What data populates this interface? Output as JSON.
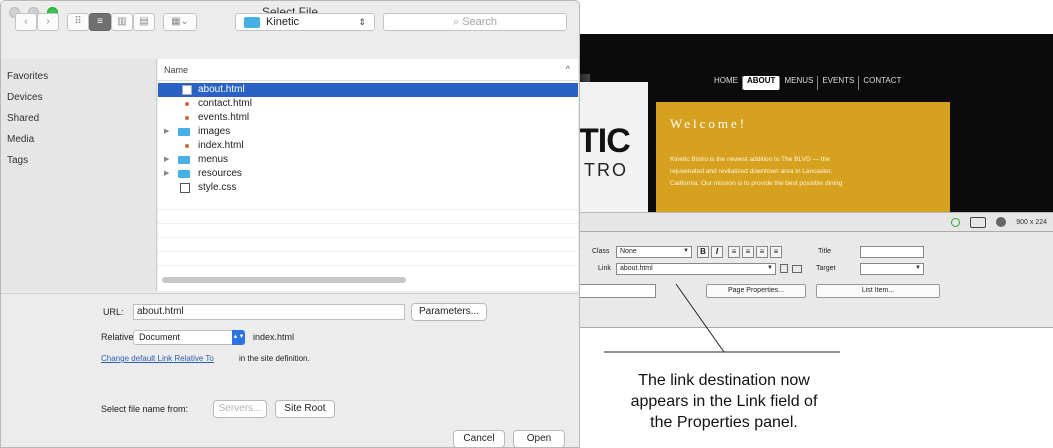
{
  "dialog": {
    "title": "Select File",
    "toolbar": {
      "back_icon": "chevron-left-icon",
      "forward_icon": "chevron-right-icon",
      "folder_name": "Kinetic",
      "search_placeholder": "Search"
    },
    "sidebar": {
      "items": [
        "Favorites",
        "Devices",
        "Shared",
        "Media",
        "Tags"
      ]
    },
    "file_list": {
      "column_header": "Name",
      "files": [
        {
          "name": "about.html",
          "type": "html",
          "selected": true
        },
        {
          "name": "contact.html",
          "type": "web"
        },
        {
          "name": "events.html",
          "type": "web"
        },
        {
          "name": "images",
          "type": "folder"
        },
        {
          "name": "index.html",
          "type": "web"
        },
        {
          "name": "menus",
          "type": "folder"
        },
        {
          "name": "resources",
          "type": "folder"
        },
        {
          "name": "style.css",
          "type": "css"
        }
      ]
    },
    "bottom": {
      "url_label": "URL:",
      "url_value": "about.html",
      "parameters_button": "Parameters...",
      "relative_label": "Relative to:",
      "relative_value": "Document",
      "relative_file": "index.html",
      "change_link": "Change default Link Relative To",
      "change_link_rest": "in the site definition.",
      "select_from_label": "Select file name from:",
      "servers_button": "Servers...",
      "site_root_button": "Site Root",
      "cancel_button": "Cancel",
      "open_button": "Open"
    }
  },
  "background_page": {
    "nav": [
      "HOME",
      "ABOUT",
      "MENUS",
      "EVENTS",
      "CONTACT"
    ],
    "active_nav": "ABOUT",
    "logo_text_1": "TIC",
    "logo_text_2": "TRO",
    "welcome": "Welcome!",
    "body_lines": [
      "Kinetic Bistro is the newest addition to The BLVD — the",
      "rejuvenated and revitalized downtown area in Lancaster,",
      "California. Our mission is to provide the best possible dining"
    ],
    "gold_color": "#d6a11f",
    "dimensions": "900 x 224"
  },
  "properties_panel": {
    "class_label": "Class",
    "class_value": "None",
    "link_label": "Link",
    "link_value": "about.html",
    "title_label": "Title",
    "target_label": "Target",
    "page_properties_button": "Page Properties...",
    "list_item_button": "List Item..."
  },
  "callout": {
    "lines": [
      "The link destination now",
      "appears in the Link field of",
      "the Properties panel."
    ]
  }
}
